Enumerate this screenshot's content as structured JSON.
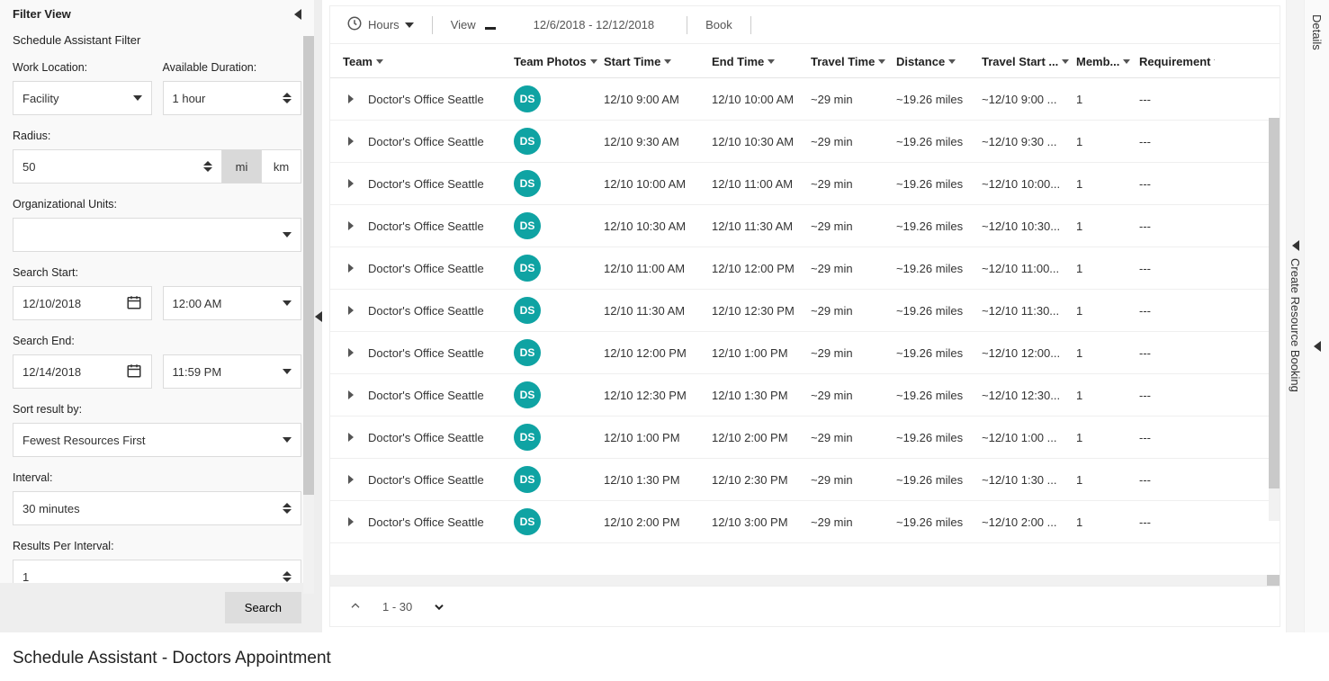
{
  "filterPanel": {
    "header": "Filter View",
    "subheader": "Schedule Assistant Filter",
    "labels": {
      "workLocation": "Work Location:",
      "availableDuration": "Available Duration:",
      "radius": "Radius:",
      "orgUnits": "Organizational Units:",
      "searchStart": "Search Start:",
      "searchEnd": "Search End:",
      "sortBy": "Sort result by:",
      "interval": "Interval:",
      "resultsPerInterval": "Results Per Interval:"
    },
    "values": {
      "workLocation": "Facility",
      "availableDuration": "1 hour",
      "radius": "50",
      "radiusUnitMi": "mi",
      "radiusUnitKm": "km",
      "orgUnits": "",
      "searchStartDate": "12/10/2018",
      "searchStartTime": "12:00 AM",
      "searchEndDate": "12/14/2018",
      "searchEndTime": "11:59 PM",
      "sortBy": "Fewest Resources First",
      "interval": "30 minutes",
      "resultsPerInterval": "1"
    },
    "searchButton": "Search"
  },
  "toolbar": {
    "hours": "Hours",
    "view": "View",
    "dateRange": "12/6/2018 - 12/12/2018",
    "book": "Book"
  },
  "columns": {
    "team": "Team",
    "photos": "Team Photos",
    "start": "Start Time",
    "end": "End Time",
    "travel": "Travel Time",
    "distance": "Distance",
    "travelStart": "Travel Start ...",
    "members": "Memb...",
    "requirement": "Requirement"
  },
  "avatarInitials": "DS",
  "rows": [
    {
      "team": "Doctor's Office Seattle",
      "start": "12/10 9:00 AM",
      "end": "12/10 10:00 AM",
      "travel": "~29 min",
      "distance": "~19.26 miles",
      "tstart": "~12/10 9:00 ...",
      "members": "1",
      "req": "---"
    },
    {
      "team": "Doctor's Office Seattle",
      "start": "12/10 9:30 AM",
      "end": "12/10 10:30 AM",
      "travel": "~29 min",
      "distance": "~19.26 miles",
      "tstart": "~12/10 9:30 ...",
      "members": "1",
      "req": "---"
    },
    {
      "team": "Doctor's Office Seattle",
      "start": "12/10 10:00 AM",
      "end": "12/10 11:00 AM",
      "travel": "~29 min",
      "distance": "~19.26 miles",
      "tstart": "~12/10 10:00...",
      "members": "1",
      "req": "---"
    },
    {
      "team": "Doctor's Office Seattle",
      "start": "12/10 10:30 AM",
      "end": "12/10 11:30 AM",
      "travel": "~29 min",
      "distance": "~19.26 miles",
      "tstart": "~12/10 10:30...",
      "members": "1",
      "req": "---"
    },
    {
      "team": "Doctor's Office Seattle",
      "start": "12/10 11:00 AM",
      "end": "12/10 12:00 PM",
      "travel": "~29 min",
      "distance": "~19.26 miles",
      "tstart": "~12/10 11:00...",
      "members": "1",
      "req": "---"
    },
    {
      "team": "Doctor's Office Seattle",
      "start": "12/10 11:30 AM",
      "end": "12/10 12:30 PM",
      "travel": "~29 min",
      "distance": "~19.26 miles",
      "tstart": "~12/10 11:30...",
      "members": "1",
      "req": "---"
    },
    {
      "team": "Doctor's Office Seattle",
      "start": "12/10 12:00 PM",
      "end": "12/10 1:00 PM",
      "travel": "~29 min",
      "distance": "~19.26 miles",
      "tstart": "~12/10 12:00...",
      "members": "1",
      "req": "---"
    },
    {
      "team": "Doctor's Office Seattle",
      "start": "12/10 12:30 PM",
      "end": "12/10 1:30 PM",
      "travel": "~29 min",
      "distance": "~19.26 miles",
      "tstart": "~12/10 12:30...",
      "members": "1",
      "req": "---"
    },
    {
      "team": "Doctor's Office Seattle",
      "start": "12/10 1:00 PM",
      "end": "12/10 2:00 PM",
      "travel": "~29 min",
      "distance": "~19.26 miles",
      "tstart": "~12/10 1:00 ...",
      "members": "1",
      "req": "---"
    },
    {
      "team": "Doctor's Office Seattle",
      "start": "12/10 1:30 PM",
      "end": "12/10 2:30 PM",
      "travel": "~29 min",
      "distance": "~19.26 miles",
      "tstart": "~12/10 1:30 ...",
      "members": "1",
      "req": "---"
    },
    {
      "team": "Doctor's Office Seattle",
      "start": "12/10 2:00 PM",
      "end": "12/10 3:00 PM",
      "travel": "~29 min",
      "distance": "~19.26 miles",
      "tstart": "~12/10 2:00 ...",
      "members": "1",
      "req": "---"
    }
  ],
  "footer": {
    "range": "1 - 30"
  },
  "rightRail": {
    "createBooking": "Create Resource Booking",
    "details": "Details"
  },
  "pageTitle": "Schedule Assistant - Doctors Appointment"
}
